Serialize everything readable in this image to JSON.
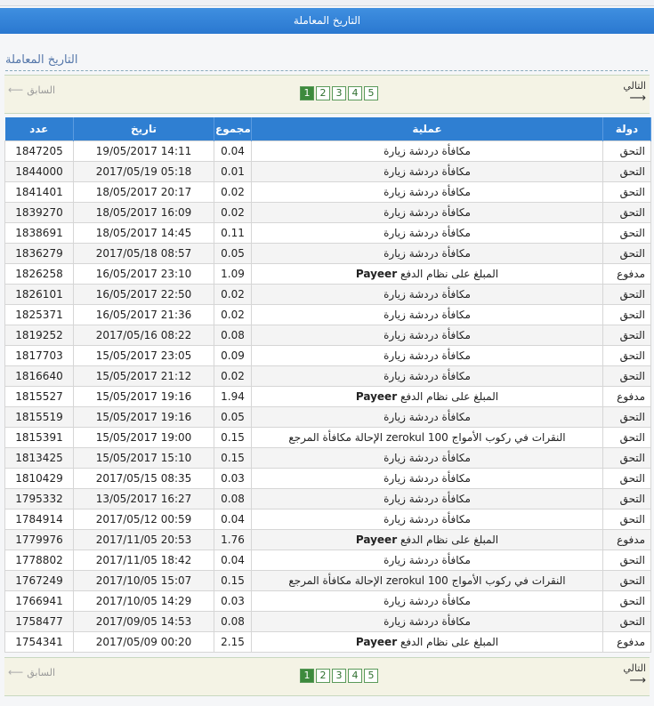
{
  "title_bar": "التاريخ المعاملة",
  "heading": "التاريخ المعاملة",
  "pager": {
    "prev_label": "السابق",
    "next_label": "التالي",
    "pages": [
      "1",
      "2",
      "3",
      "4",
      "5"
    ],
    "current": "1"
  },
  "table": {
    "headers": {
      "number": "عدد",
      "date": "تاريخ",
      "amount": "مجموع",
      "operation": "عملية",
      "status": "دولة"
    },
    "rows": [
      {
        "number": "1847205",
        "date": "19/05/2017 14:11",
        "amount": "0.04",
        "operation": "مكافأة دردشة زيارة",
        "status": "التحق"
      },
      {
        "number": "1844000",
        "date": "2017/05/19 05:18",
        "amount": "0.01",
        "operation": "مكافأة دردشة زيارة",
        "status": "التحق"
      },
      {
        "number": "1841401",
        "date": "18/05/2017 20:17",
        "amount": "0.02",
        "operation": "مكافأة دردشة زيارة",
        "status": "التحق"
      },
      {
        "number": "1839270",
        "date": "18/05/2017 16:09",
        "amount": "0.02",
        "operation": "مكافأة دردشة زيارة",
        "status": "التحق"
      },
      {
        "number": "1838691",
        "date": "18/05/2017 14:45",
        "amount": "0.11",
        "operation": "مكافأة دردشة زيارة",
        "status": "التحق"
      },
      {
        "number": "1836279",
        "date": "2017/05/18 08:57",
        "amount": "0.05",
        "operation": "مكافأة دردشة زيارة",
        "status": "التحق"
      },
      {
        "number": "1826258",
        "date": "16/05/2017 23:10",
        "amount": "1.09",
        "operation": "المبلغ على نظام الدفع",
        "op_brand": "Payeer",
        "status": "مدفوع"
      },
      {
        "number": "1826101",
        "date": "16/05/2017 22:50",
        "amount": "0.02",
        "operation": "مكافأة دردشة زيارة",
        "status": "التحق"
      },
      {
        "number": "1825371",
        "date": "16/05/2017 21:36",
        "amount": "0.02",
        "operation": "مكافأة دردشة زيارة",
        "status": "التحق"
      },
      {
        "number": "1819252",
        "date": "2017/05/16 08:22",
        "amount": "0.08",
        "operation": "مكافأة دردشة زيارة",
        "status": "التحق"
      },
      {
        "number": "1817703",
        "date": "15/05/2017 23:05",
        "amount": "0.09",
        "operation": "مكافأة دردشة زيارة",
        "status": "التحق"
      },
      {
        "number": "1816640",
        "date": "15/05/2017 21:12",
        "amount": "0.02",
        "operation": "مكافأة دردشة زيارة",
        "status": "التحق"
      },
      {
        "number": "1815527",
        "date": "15/05/2017 19:16",
        "amount": "1.94",
        "operation": "المبلغ على نظام الدفع",
        "op_brand": "Payeer",
        "status": "مدفوع"
      },
      {
        "number": "1815519",
        "date": "15/05/2017 19:16",
        "amount": "0.05",
        "operation": "مكافأة دردشة زيارة",
        "status": "التحق"
      },
      {
        "number": "1815391",
        "date": "15/05/2017 19:00",
        "amount": "0.15",
        "operation": "النقرات في ركوب الأمواج zerokul 100 الإحالة مكافأة المرجع",
        "status": "التحق"
      },
      {
        "number": "1813425",
        "date": "15/05/2017 15:10",
        "amount": "0.15",
        "operation": "مكافأة دردشة زيارة",
        "status": "التحق"
      },
      {
        "number": "1810429",
        "date": "2017/05/15 08:35",
        "amount": "0.03",
        "operation": "مكافأة دردشة زيارة",
        "status": "التحق"
      },
      {
        "number": "1795332",
        "date": "13/05/2017 16:27",
        "amount": "0.08",
        "operation": "مكافأة دردشة زيارة",
        "status": "التحق"
      },
      {
        "number": "1784914",
        "date": "2017/05/12 00:59",
        "amount": "0.04",
        "operation": "مكافأة دردشة زيارة",
        "status": "التحق"
      },
      {
        "number": "1779976",
        "date": "2017/11/05 20:53",
        "amount": "1.76",
        "operation": "المبلغ على نظام الدفع",
        "op_brand": "Payeer",
        "status": "مدفوع"
      },
      {
        "number": "1778802",
        "date": "2017/11/05 18:42",
        "amount": "0.04",
        "operation": "مكافأة دردشة زيارة",
        "status": "التحق"
      },
      {
        "number": "1767249",
        "date": "2017/10/05 15:07",
        "amount": "0.15",
        "operation": "النقرات في ركوب الأمواج zerokul 100 الإحالة مكافأة المرجع",
        "status": "التحق"
      },
      {
        "number": "1766941",
        "date": "2017/10/05 14:29",
        "amount": "0.03",
        "operation": "مكافأة دردشة زيارة",
        "status": "التحق"
      },
      {
        "number": "1758477",
        "date": "2017/09/05 14:53",
        "amount": "0.08",
        "operation": "مكافأة دردشة زيارة",
        "status": "التحق"
      },
      {
        "number": "1754341",
        "date": "2017/05/09 00:20",
        "amount": "2.15",
        "operation": "المبلغ على نظام الدفع",
        "op_brand": "Payeer",
        "status": "مدفوع"
      }
    ]
  },
  "colors": {
    "header_blue": "#2f7fd2",
    "pager_green": "#3d8a3d",
    "pager_bg": "#f4f3e5"
  }
}
